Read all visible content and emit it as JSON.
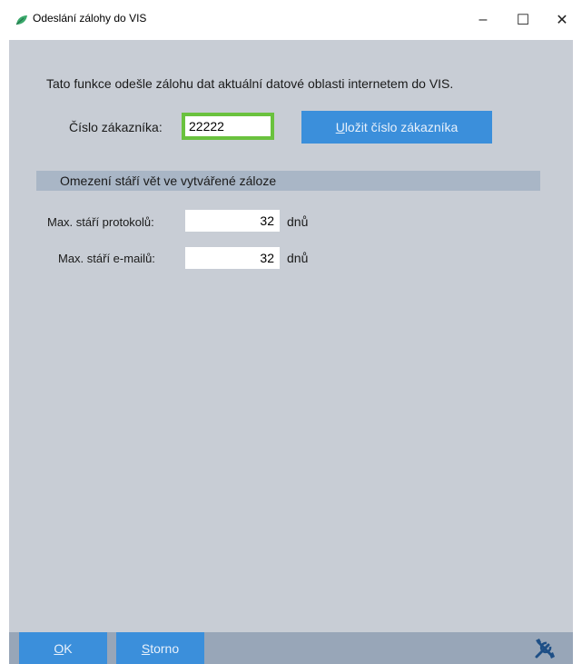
{
  "window": {
    "title": "Odeslání zálohy do VIS",
    "minimize_glyph": "–",
    "maximize_glyph": "☐",
    "close_glyph": "✕"
  },
  "main": {
    "description": "Tato funkce odešle zálohu dat aktuální datové oblasti internetem do VIS.",
    "customer_label": "Číslo zákazníka:",
    "customer_value": "22222",
    "save_button": {
      "accel": "U",
      "rest": "ložit číslo zákazníka"
    },
    "section_title": "Omezení stáří vět ve vytvářené záloze",
    "rows": [
      {
        "label": "Max. stáří protokolů:",
        "value": "32",
        "unit": "dnů"
      },
      {
        "label": "Max. stáří e-mailů:",
        "value": "32",
        "unit": "dnů"
      }
    ]
  },
  "footer": {
    "ok": {
      "accel": "O",
      "rest": "K"
    },
    "storno": {
      "accel": "S",
      "rest": "torno"
    },
    "tools_icon": "tools-icon"
  },
  "colors": {
    "content_bg": "#c8cdd5",
    "footer_bg": "#98a6b8",
    "button_blue": "#3b8fdb",
    "section_bar": "#a9b6c6",
    "focus_green": "#6ac23e"
  }
}
